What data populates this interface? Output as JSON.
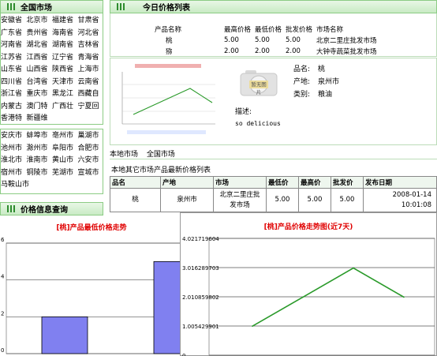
{
  "sidebar": {
    "provinces_header": "全国市场",
    "provinces": [
      [
        "安徽省",
        "北京市",
        "福建省",
        "甘肃省"
      ],
      [
        "广东省",
        "贵州省",
        "海南省",
        "河北省"
      ],
      [
        "河南省",
        "湖北省",
        "湖南省",
        "吉林省"
      ],
      [
        "江苏省",
        "江西省",
        "辽宁省",
        "青海省"
      ],
      [
        "山东省",
        "山西省",
        "陕西省",
        "上海市"
      ],
      [
        "四川省",
        "台湾省",
        "天津市",
        "云南省"
      ],
      [
        "浙江省",
        "重庆市",
        "黑龙江",
        "西藏自"
      ],
      [
        "内蒙古",
        "澳门特",
        "广西壮",
        "宁夏回"
      ],
      [
        "香港特",
        "新疆维"
      ]
    ],
    "cities": [
      [
        "安庆市",
        "蚌埠市",
        "亳州市",
        "巢湖市"
      ],
      [
        "池州市",
        "滁州市",
        "阜阳市",
        "合肥市"
      ],
      [
        "淮北市",
        "淮南市",
        "黄山市",
        "六安市"
      ],
      [
        "宿州市",
        "铜陵市",
        "芜湖市",
        "宣城市"
      ],
      [
        "马鞍山市"
      ]
    ],
    "price_query_header": "价格信息查询"
  },
  "today": {
    "header": "今日价格列表",
    "columns": [
      "产品名称",
      "最高价格",
      "最低价格",
      "批发价格",
      "市场名称"
    ],
    "rows": [
      [
        "桃",
        "5.00",
        "5.00",
        "5.00",
        "北京二里庄批发市场"
      ],
      [
        "猕",
        "2.00",
        "2.00",
        "2.00",
        "大钟寺蔬菜批发市场"
      ]
    ]
  },
  "detail": {
    "photo_caption": "暂无图片",
    "name_label": "品名:",
    "name_value": "桃",
    "origin_label": "产地:",
    "origin_value": "泉州市",
    "category_label": "类别:",
    "category_value": "粮油",
    "desc_label": "描述:",
    "desc_value": "so delicious"
  },
  "links": {
    "local_market": "本地市场",
    "national_market": "全国市场"
  },
  "other_markets": {
    "caption": "本地其它市场产品最新价格列表",
    "columns": [
      "品名",
      "产地",
      "市场",
      "最低价",
      "最高价",
      "批发价",
      "发布日期"
    ],
    "rows": [
      {
        "name": "桃",
        "origin": "泉州市",
        "market": "北京二里庄批发市场",
        "low": "5.00",
        "high": "5.00",
        "wholesale": "5.00",
        "date": "2008-01-14",
        "time": "10:01:08"
      }
    ]
  },
  "chart_data": [
    {
      "type": "bar",
      "title": "[桃]产品最低价格走势",
      "ylim": [
        0,
        6
      ],
      "y_ticks": [
        "0",
        "2",
        "4",
        "6"
      ],
      "values": [
        2,
        5
      ],
      "color": "#8080f0"
    },
    {
      "type": "line",
      "title": "[桃]产品价格走势图(近7天)",
      "ylim": [
        0,
        4.021719604
      ],
      "y_ticks": [
        "0",
        "1.005429901",
        "2.010859802",
        "3.016289703",
        "4.021719604"
      ],
      "values": [
        1.0,
        2.0,
        3.0,
        2.0
      ],
      "color": "#2a9a2a"
    }
  ]
}
